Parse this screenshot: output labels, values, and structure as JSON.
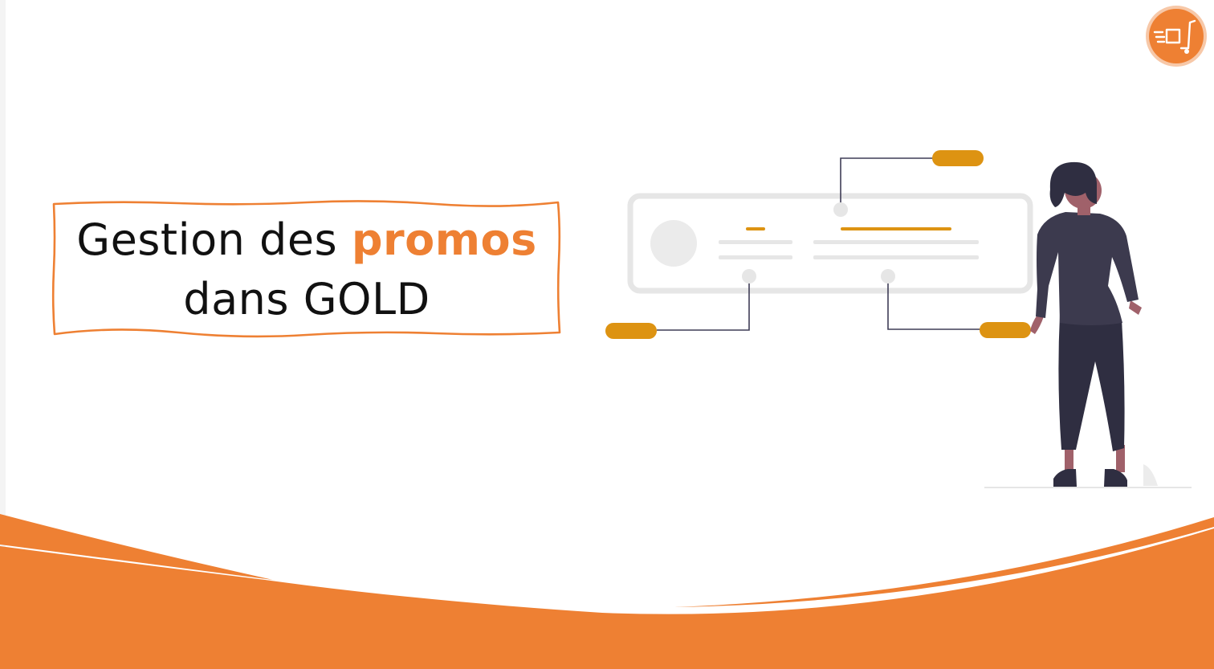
{
  "title": {
    "part1": "Gestion des ",
    "highlight": "promos",
    "line2": "dans GOLD"
  },
  "colors": {
    "accent_orange": "#ee8033",
    "tag_gold": "#dd9312",
    "figure_dark": "#3c3a4e",
    "skin": "#a0616a",
    "placeholder_gray": "#e6e6e6"
  },
  "icons": {
    "brand": "delivery-cart-icon"
  }
}
